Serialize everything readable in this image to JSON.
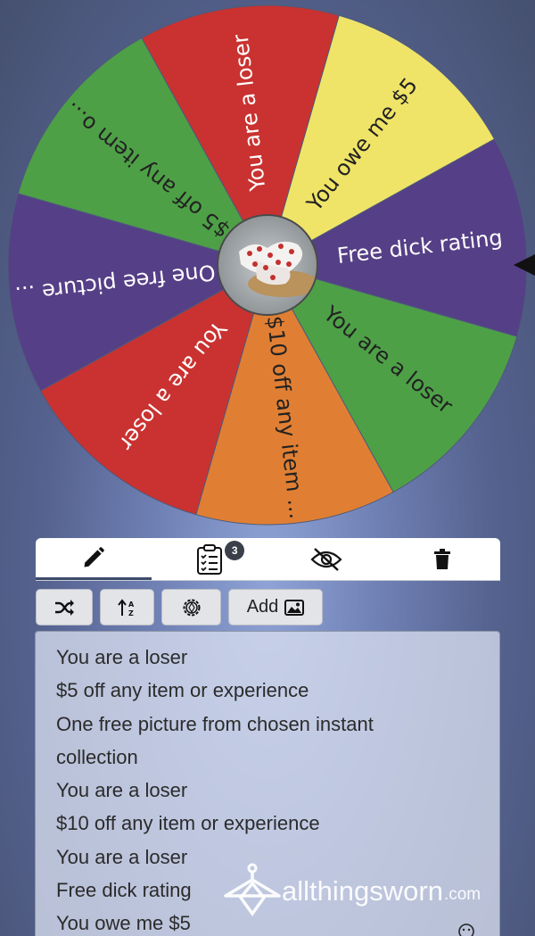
{
  "wheel": {
    "pointer": "pointer-left-icon",
    "center_image": "socks-photo",
    "segments": [
      {
        "label": "You owe me $5",
        "color": "#efe467",
        "text_color": "#222222"
      },
      {
        "label": "Free dick rating",
        "color": "#553f86",
        "text_color": "#ffffff"
      },
      {
        "label": "You are a loser",
        "color": "#4ea047",
        "text_color": "#222222"
      },
      {
        "label": "$10 off any item ...",
        "color": "#e07f33",
        "text_color": "#222222"
      },
      {
        "label": "You are a loser",
        "color": "#c93230",
        "text_color": "#ffffff"
      },
      {
        "label": "One free picture ...",
        "color": "#553f86",
        "text_color": "#ffffff"
      },
      {
        "label": "$5 off any item o...",
        "color": "#4ea047",
        "text_color": "#222222"
      },
      {
        "label": "You are a loser",
        "color": "#c93230",
        "text_color": "#ffffff"
      }
    ]
  },
  "tabs": [
    {
      "icon": "pencil-icon",
      "active": true
    },
    {
      "icon": "clipboard-list-icon",
      "badge": "3"
    },
    {
      "icon": "eye-slash-icon"
    },
    {
      "icon": "trash-icon"
    }
  ],
  "toolbar": {
    "shuffle_icon": "shuffle-icon",
    "sort_icon": "sort-az-icon",
    "settings_icon": "gear-icon",
    "add_label": "Add",
    "add_icon": "image-icon"
  },
  "entries": [
    "You are a loser",
    "$5 off any item or experience",
    "One free picture from chosen instant",
    "collection",
    "You are a loser",
    "$10 off any item or experience",
    "You are a loser",
    "Free dick rating",
    "You owe me $5"
  ],
  "watermark": {
    "name": "allthingsworn",
    "domain": ".com"
  }
}
